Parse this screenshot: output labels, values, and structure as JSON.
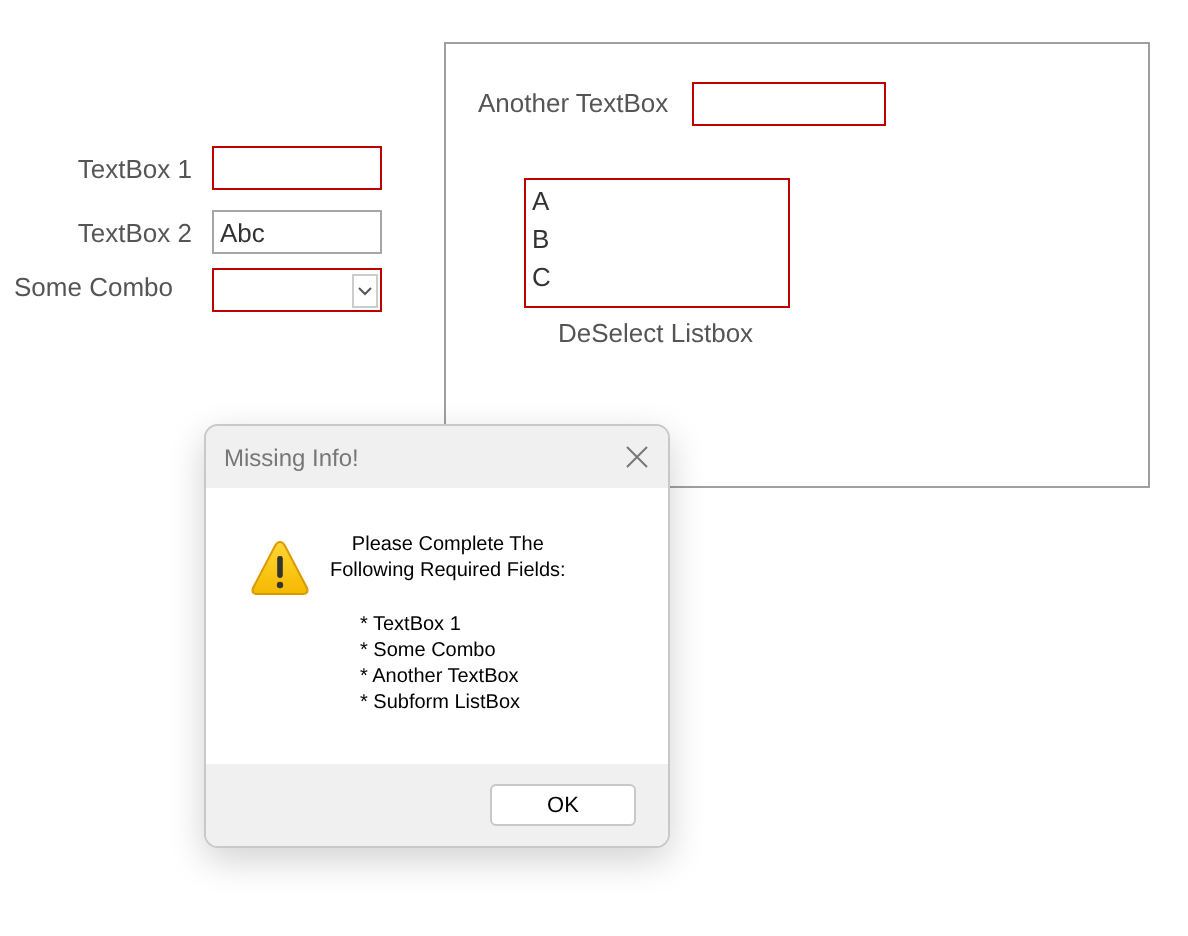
{
  "form": {
    "fields": [
      {
        "label": "TextBox 1",
        "kind": "text",
        "missing": true
      },
      {
        "label": "TextBox 2",
        "kind": "text",
        "value": "Abc",
        "missing": false
      },
      {
        "label": "Some Combo",
        "kind": "combo",
        "missing": true
      }
    ]
  },
  "subform": {
    "field": {
      "label": "Another TextBox",
      "missing": true
    },
    "listbox": {
      "items": [
        "A",
        "B",
        "C"
      ],
      "missing": true
    },
    "button": "DeSelect Listbox"
  },
  "dialog": {
    "title": "Missing Info!",
    "message_lines": [
      "Please Complete The",
      "Following Required Fields:"
    ],
    "required_fields": [
      "* TextBox 1",
      "* Some Combo",
      "* Another TextBox",
      "* Subform ListBox"
    ],
    "button": "OK"
  }
}
